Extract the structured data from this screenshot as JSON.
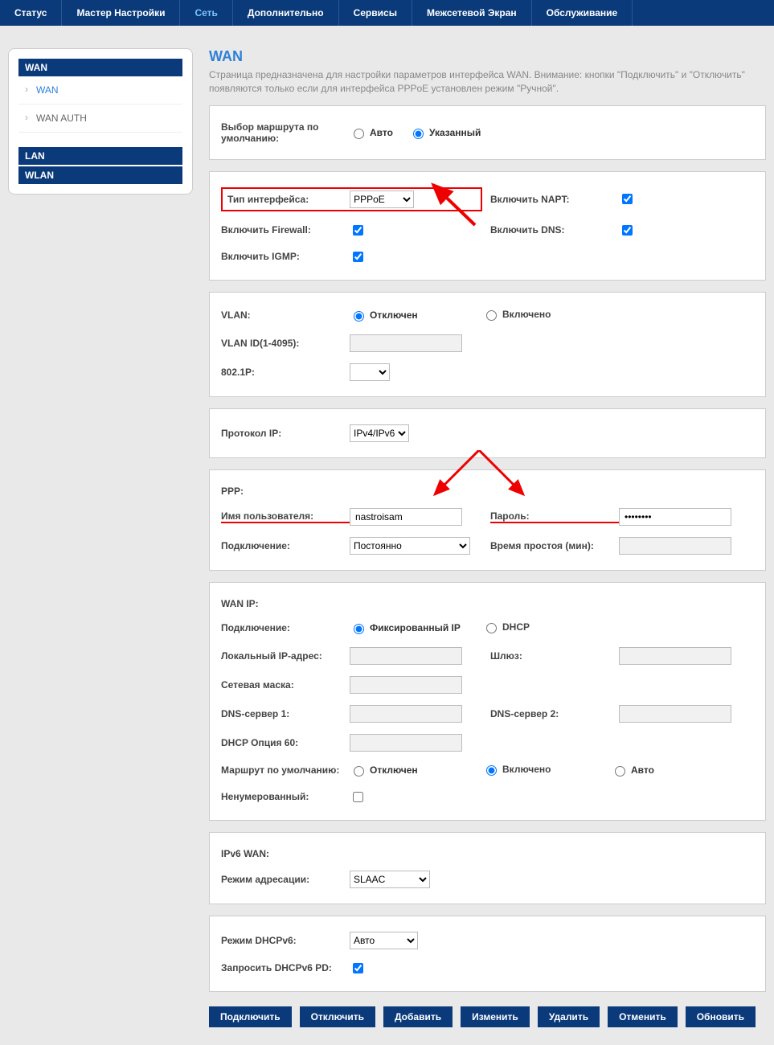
{
  "topnav": {
    "items": [
      "Статус",
      "Мастер Настройки",
      "Сеть",
      "Дополнительно",
      "Сервисы",
      "Межсетевой Экран",
      "Обслуживание"
    ],
    "active_index": 2
  },
  "sidebar": {
    "sections": [
      {
        "title": "WAN",
        "items": [
          "WAN",
          "WAN AUTH"
        ],
        "active_item": 0
      },
      {
        "title": "LAN",
        "items": []
      },
      {
        "title": "WLAN",
        "items": []
      }
    ]
  },
  "page": {
    "title": "WAN",
    "desc": "Страница предназначена для настройки параметров интерфейса WAN. Внимание: кнопки \"Подключить\" и \"Отключить\" появляются только если для интерфейса PPPoE установлен режим \"Ручной\"."
  },
  "panel_route": {
    "label": "Выбор маршрута по умолчанию:",
    "options": [
      "Авто",
      "Указанный"
    ],
    "selected": "Указанный"
  },
  "panel_iface": {
    "type_label": "Тип интерфейса:",
    "type_options": [
      "PPPoE"
    ],
    "type_value": "PPPoE",
    "napt_label": "Включить NAPT:",
    "napt_checked": true,
    "fw_label": "Включить Firewall:",
    "fw_checked": true,
    "dns_label": "Включить DNS:",
    "dns_checked": true,
    "igmp_label": "Включить IGMP:",
    "igmp_checked": true
  },
  "panel_vlan": {
    "vlan_label": "VLAN:",
    "vlan_options": [
      "Отключен",
      "Включено"
    ],
    "vlan_selected": "Отключен",
    "vlanid_label": "VLAN ID(1-4095):",
    "vlanid_value": "",
    "p8021_label": "802.1P:",
    "p8021_options": [
      ""
    ]
  },
  "panel_proto": {
    "label": "Протокол IP:",
    "options": [
      "IPv4/IPv6"
    ],
    "value": "IPv4/IPv6"
  },
  "panel_ppp": {
    "ppp_label": "PPP:",
    "user_label": "Имя пользователя:",
    "user_value": "nastroisam",
    "pass_label": "Пароль:",
    "pass_value": "••••••••",
    "conn_label": "Подключение:",
    "conn_options": [
      "Постоянно"
    ],
    "conn_value": "Постоянно",
    "idle_label": "Время простоя (мин):",
    "idle_value": ""
  },
  "panel_wanip": {
    "header": "WAN IP:",
    "conn_label": "Подключение:",
    "conn_options": [
      "Фиксированный IP",
      "DHCP"
    ],
    "conn_selected": "Фиксированный IP",
    "localip_label": "Локальный IP-адрес:",
    "gw_label": "Шлюз:",
    "mask_label": "Сетевая маска:",
    "dns1_label": "DNS-сервер 1:",
    "dns2_label": "DNS-сервер 2:",
    "dhcp60_label": "DHCP Опция 60:",
    "defroute_label": "Маршрут по умолчанию:",
    "defroute_options": [
      "Отключен",
      "Включено",
      "Авто"
    ],
    "defroute_selected": "Включено",
    "unnum_label": "Ненумерованный:",
    "unnum_checked": false
  },
  "panel_ipv6wan": {
    "header": "IPv6 WAN:",
    "mode_label": "Режим адресации:",
    "mode_options": [
      "SLAAC"
    ],
    "mode_value": "SLAAC"
  },
  "panel_dhcpv6": {
    "mode_label": "Режим DHCPv6:",
    "mode_options": [
      "Авто"
    ],
    "mode_value": "Авто",
    "pd_label": "Запросить DHCPv6 PD:",
    "pd_checked": true
  },
  "buttons": [
    "Подключить",
    "Отключить",
    "Добавить",
    "Изменить",
    "Удалить",
    "Отменить",
    "Обновить"
  ]
}
